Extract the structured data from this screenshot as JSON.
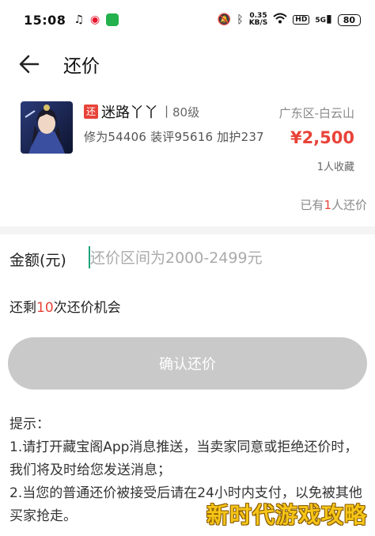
{
  "status_bar": {
    "time": "15:08",
    "net_speed_value": "0.35",
    "net_speed_unit": "KB/S",
    "hd": "HD",
    "signal": "5G",
    "battery": "80"
  },
  "nav": {
    "title": "还价"
  },
  "item": {
    "tag": "还",
    "name": "迷路丫丫",
    "separator": "|",
    "level": "80级",
    "stats": "修为54406 装评95616 加护237",
    "server": "广东区-白云山",
    "price": "¥2,500",
    "favorites": "1人收藏",
    "offers_prefix": "已有",
    "offers_count": "1",
    "offers_suffix": "人还价"
  },
  "amount": {
    "label": "金额(元)",
    "placeholder": "还价区间为2000-2499元",
    "value": ""
  },
  "remaining": {
    "prefix": "还剩",
    "count": "10",
    "suffix": "次还价机会"
  },
  "confirm_label": "确认还价",
  "tips": {
    "title": "提示：",
    "line1": "1.请打开藏宝阁App消息推送，当卖家同意或拒绝还价时，我们将及时给您发送消息；",
    "line2": "2.当您的普通还价被接受后请在24小时内支付，以免被其他买家抢走。"
  },
  "watermark": "新时代游戏攻略",
  "colors": {
    "accent_red": "#e84339",
    "button_disabled": "#c9c9c9",
    "cursor_green": "#1fa37c"
  }
}
